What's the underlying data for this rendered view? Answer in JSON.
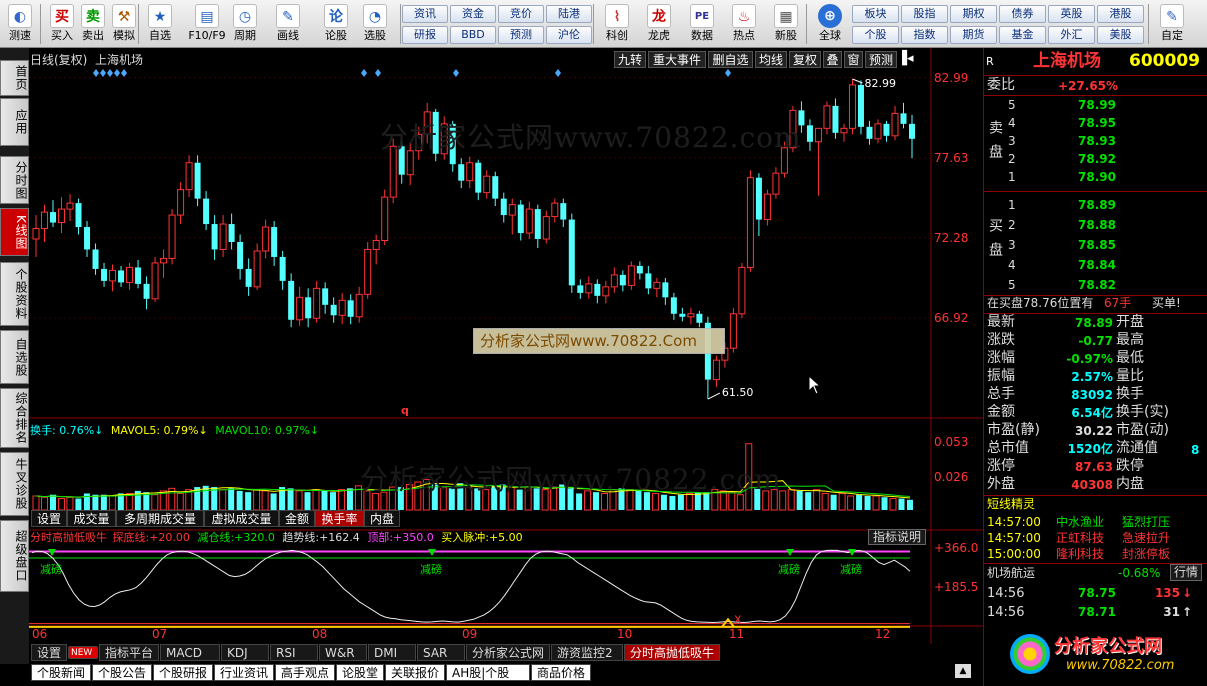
{
  "toolbar": {
    "buttons": [
      {
        "label": "测速",
        "glyph": "◐",
        "color": "#3366cc"
      },
      {
        "label": "买入",
        "glyph": "买",
        "color": "#cc0000"
      },
      {
        "label": "卖出",
        "glyph": "卖",
        "color": "#009900"
      },
      {
        "label": "模拟",
        "glyph": "⚒",
        "color": "#aa5500"
      },
      {
        "label": "自选",
        "glyph": "★",
        "color": "#1f5fbf"
      },
      {
        "label": "F10/F9",
        "glyph": "▤",
        "color": "#1f5fbf"
      },
      {
        "label": "周期",
        "glyph": "◷",
        "color": "#1f5fbf"
      },
      {
        "label": "画线",
        "glyph": "✎",
        "color": "#1f5fbf"
      },
      {
        "label": "论股",
        "glyph": "论",
        "color": "#1f5fbf"
      },
      {
        "label": "选股",
        "glyph": "◔",
        "color": "#1f5fbf"
      }
    ],
    "quick_top": [
      "资讯",
      "资金",
      "竞价",
      "陆港"
    ],
    "quick_bottom": [
      "研报",
      "BBD",
      "预测",
      "沪伦"
    ],
    "buttons2": [
      {
        "label": "科创",
        "glyph": "⌇",
        "color": "#cc3333"
      },
      {
        "label": "龙虎",
        "glyph": "龙",
        "color": "#cc0000"
      },
      {
        "label": "数据",
        "glyph": "PE",
        "color": "#333399"
      },
      {
        "label": "热点",
        "glyph": "♨",
        "color": "#cc0000"
      },
      {
        "label": "新股",
        "glyph": "▦",
        "color": "#555"
      }
    ],
    "globe_label": "全球",
    "quick2_top": [
      "板块",
      "股指",
      "期权",
      "债券",
      "英股",
      "港股"
    ],
    "quick2_bottom": [
      "个股",
      "指数",
      "期货",
      "基金",
      "外汇",
      "美股"
    ],
    "custom_label": "自定"
  },
  "left_tabs": [
    "首页",
    "应用",
    "分时图",
    "K线图",
    "个股资料",
    "自选股",
    "综合排名",
    "牛叉诊股",
    "超级盘口"
  ],
  "chart_header": {
    "period": "日线(复权)",
    "stock_name": "上海机场",
    "buttons": [
      "九转",
      "重大事件",
      "删自选",
      "均线",
      "复权",
      "叠",
      "窗",
      "预测"
    ]
  },
  "watermark": "分析家公式网www.70822.com",
  "watermark_box": "分析家公式网www.70822.Com",
  "chart_data": [
    {
      "type": "candlestick",
      "title": "日线(复权) 上海机场",
      "price_labels": [
        "82.99",
        "77.63",
        "72.28",
        "66.92"
      ],
      "ylim": [
        60.5,
        83.5
      ],
      "high_label": "82.99",
      "low_label": "61.50",
      "candles": [
        [
          72.2,
          73.8,
          71.0,
          72.9
        ],
        [
          72.9,
          74.5,
          72.0,
          74.0
        ],
        [
          74.0,
          74.8,
          73.0,
          73.3
        ],
        [
          73.3,
          75.0,
          72.6,
          74.2
        ],
        [
          74.2,
          75.2,
          73.4,
          74.6
        ],
        [
          74.6,
          74.9,
          72.5,
          73.0
        ],
        [
          73.0,
          73.4,
          71.0,
          71.5
        ],
        [
          71.5,
          71.9,
          69.8,
          70.2
        ],
        [
          70.2,
          70.6,
          69.0,
          69.4
        ],
        [
          69.4,
          70.5,
          68.7,
          70.1
        ],
        [
          70.1,
          70.4,
          69.0,
          69.3
        ],
        [
          69.3,
          70.6,
          68.8,
          70.3
        ],
        [
          70.3,
          70.8,
          68.9,
          69.2
        ],
        [
          69.2,
          69.7,
          67.5,
          68.2
        ],
        [
          68.2,
          71.0,
          68.0,
          70.6
        ],
        [
          70.6,
          71.5,
          69.6,
          70.9
        ],
        [
          70.9,
          74.2,
          70.5,
          73.8
        ],
        [
          73.8,
          76.0,
          73.2,
          75.5
        ],
        [
          75.5,
          77.8,
          75.0,
          77.3
        ],
        [
          77.3,
          77.8,
          74.4,
          74.9
        ],
        [
          74.9,
          75.4,
          72.8,
          73.2
        ],
        [
          73.2,
          73.8,
          70.8,
          71.5
        ],
        [
          71.5,
          73.8,
          71.0,
          73.2
        ],
        [
          73.2,
          73.9,
          71.5,
          72.0
        ],
        [
          72.0,
          72.5,
          69.5,
          70.2
        ],
        [
          70.2,
          70.9,
          68.4,
          69.0
        ],
        [
          69.0,
          71.9,
          68.8,
          71.4
        ],
        [
          71.4,
          73.5,
          70.9,
          73.0
        ],
        [
          73.0,
          73.4,
          70.4,
          71.0
        ],
        [
          71.0,
          71.4,
          68.8,
          69.4
        ],
        [
          69.4,
          69.9,
          66.3,
          66.8
        ],
        [
          66.8,
          69.0,
          66.4,
          68.3
        ],
        [
          68.3,
          68.9,
          66.3,
          66.9
        ],
        [
          66.9,
          69.4,
          66.6,
          68.9
        ],
        [
          68.9,
          69.3,
          67.2,
          67.8
        ],
        [
          67.8,
          68.3,
          66.6,
          67.1
        ],
        [
          67.1,
          68.6,
          66.5,
          68.1
        ],
        [
          68.1,
          68.5,
          66.5,
          67.0
        ],
        [
          67.0,
          69.0,
          66.6,
          68.5
        ],
        [
          68.5,
          72.0,
          68.2,
          71.5
        ],
        [
          71.5,
          72.5,
          70.5,
          72.1
        ],
        [
          72.1,
          75.5,
          71.8,
          75.0
        ],
        [
          75.0,
          78.9,
          74.6,
          78.4
        ],
        [
          78.4,
          79.1,
          75.9,
          76.5
        ],
        [
          76.5,
          78.6,
          75.8,
          78.1
        ],
        [
          78.1,
          79.7,
          77.5,
          79.2
        ],
        [
          79.2,
          81.3,
          78.6,
          80.7
        ],
        [
          80.7,
          80.9,
          77.4,
          77.9
        ],
        [
          77.9,
          80.4,
          77.5,
          79.9
        ],
        [
          79.9,
          80.1,
          76.7,
          77.2
        ],
        [
          77.2,
          77.6,
          75.6,
          76.1
        ],
        [
          76.1,
          77.7,
          75.6,
          77.3
        ],
        [
          77.3,
          77.5,
          74.8,
          75.3
        ],
        [
          75.3,
          76.8,
          74.9,
          76.4
        ],
        [
          76.4,
          76.7,
          74.4,
          74.9
        ],
        [
          74.9,
          75.3,
          73.3,
          73.8
        ],
        [
          73.8,
          74.9,
          72.5,
          74.5
        ],
        [
          74.5,
          74.8,
          72.1,
          72.6
        ],
        [
          72.6,
          74.7,
          72.2,
          74.2
        ],
        [
          74.2,
          74.5,
          71.6,
          72.2
        ],
        [
          72.2,
          74.1,
          71.9,
          73.7
        ],
        [
          73.7,
          74.9,
          73.3,
          74.6
        ],
        [
          74.6,
          74.9,
          73.0,
          73.5
        ],
        [
          73.5,
          73.9,
          68.6,
          69.1
        ],
        [
          69.1,
          69.5,
          68.2,
          68.6
        ],
        [
          68.6,
          69.7,
          68.2,
          69.2
        ],
        [
          69.2,
          69.5,
          67.9,
          68.4
        ],
        [
          68.4,
          69.4,
          67.9,
          69.0
        ],
        [
          69.0,
          70.3,
          68.6,
          69.8
        ],
        [
          69.8,
          70.1,
          68.7,
          69.1
        ],
        [
          69.1,
          70.7,
          68.8,
          70.4
        ],
        [
          70.4,
          70.7,
          69.5,
          69.9
        ],
        [
          69.9,
          70.4,
          68.5,
          68.9
        ],
        [
          68.9,
          69.6,
          68.3,
          69.3
        ],
        [
          69.3,
          69.6,
          67.8,
          68.3
        ],
        [
          68.3,
          68.6,
          66.8,
          67.2
        ],
        [
          67.2,
          67.6,
          66.7,
          67.0
        ],
        [
          67.0,
          67.6,
          66.5,
          67.2
        ],
        [
          67.2,
          67.4,
          66.3,
          66.6
        ],
        [
          66.6,
          67.0,
          61.5,
          62.8
        ],
        [
          62.8,
          64.4,
          62.3,
          64.1
        ],
        [
          64.1,
          65.3,
          63.6,
          64.9
        ],
        [
          64.9,
          67.6,
          64.6,
          67.2
        ],
        [
          67.2,
          70.6,
          66.9,
          70.3
        ],
        [
          70.3,
          76.8,
          70.0,
          76.3
        ],
        [
          76.3,
          76.6,
          72.4,
          73.5
        ],
        [
          73.5,
          75.5,
          73.1,
          75.2
        ],
        [
          75.2,
          77.0,
          74.9,
          76.6
        ],
        [
          76.6,
          78.7,
          76.3,
          78.3
        ],
        [
          78.3,
          81.1,
          78.0,
          80.8
        ],
        [
          80.8,
          81.4,
          79.3,
          79.8
        ],
        [
          79.8,
          80.2,
          78.1,
          78.7
        ],
        [
          78.7,
          79.1,
          75.1,
          79.6
        ],
        [
          79.6,
          81.4,
          79.2,
          81.1
        ],
        [
          81.1,
          81.6,
          78.9,
          79.3
        ],
        [
          79.3,
          79.9,
          78.7,
          79.6
        ],
        [
          79.6,
          82.9,
          79.2,
          82.5
        ],
        [
          82.5,
          82.8,
          79.2,
          79.7
        ],
        [
          79.7,
          80.1,
          78.5,
          78.9
        ],
        [
          78.9,
          80.2,
          78.6,
          79.9
        ],
        [
          79.9,
          80.1,
          78.7,
          79.1
        ],
        [
          79.1,
          81.1,
          78.8,
          80.6
        ],
        [
          80.6,
          81.3,
          79.6,
          79.9
        ],
        [
          79.9,
          80.5,
          77.6,
          78.9
        ]
      ]
    },
    {
      "type": "bar",
      "title": "换手",
      "series": [
        {
          "name": "换手",
          "label": "0.76%↓"
        },
        {
          "name": "MAVOL5",
          "label": "0.79%↓"
        },
        {
          "name": "MAVOL10",
          "label": "0.97%↓"
        }
      ],
      "axis_labels": [
        "0.053",
        "0.026"
      ],
      "ylim": [
        0,
        0.062
      ],
      "values": [
        0.011,
        0.01,
        0.012,
        0.009,
        0.01,
        0.009,
        0.013,
        0.012,
        0.012,
        0.011,
        0.013,
        0.013,
        0.015,
        0.014,
        0.012,
        0.015,
        0.017,
        0.013,
        0.016,
        0.018,
        0.019,
        0.018,
        0.016,
        0.017,
        0.015,
        0.014,
        0.016,
        0.015,
        0.013,
        0.018,
        0.017,
        0.015,
        0.014,
        0.016,
        0.015,
        0.014,
        0.016,
        0.017,
        0.019,
        0.015,
        0.013,
        0.014,
        0.018,
        0.018,
        0.02,
        0.022,
        0.024,
        0.02,
        0.018,
        0.017,
        0.021,
        0.019,
        0.017,
        0.016,
        0.019,
        0.02,
        0.018,
        0.016,
        0.018,
        0.017,
        0.016,
        0.018,
        0.02,
        0.017,
        0.013,
        0.015,
        0.014,
        0.013,
        0.016,
        0.017,
        0.016,
        0.015,
        0.014,
        0.013,
        0.012,
        0.011,
        0.012,
        0.013,
        0.014,
        0.014,
        0.016,
        0.015,
        0.014,
        0.012,
        0.052,
        0.017,
        0.015,
        0.016,
        0.015,
        0.016,
        0.015,
        0.014,
        0.016,
        0.013,
        0.012,
        0.013,
        0.011,
        0.012,
        0.011,
        0.011,
        0.01,
        0.009,
        0.009,
        0.008
      ]
    },
    {
      "type": "line",
      "title": "分时高抛低吸牛",
      "series": [
        {
          "name": "探底线",
          "label": "+20.00"
        },
        {
          "name": "减仓线",
          "label": "+320.0"
        },
        {
          "name": "趋势线",
          "label": "+162.4"
        },
        {
          "name": "顶部",
          "label": "+350.0"
        },
        {
          "name": "买入脉冲",
          "label": "+5.00"
        }
      ],
      "axis_labels": [
        "+366.0",
        "+185.5"
      ],
      "ylim": [
        0,
        366
      ],
      "values": [
        345,
        352,
        350,
        340,
        320,
        290,
        250,
        200,
        160,
        130,
        110,
        100,
        98,
        105,
        120,
        140,
        155,
        165,
        170,
        175,
        185,
        205,
        230,
        260,
        290,
        315,
        335,
        345,
        350,
        352,
        348,
        340,
        330,
        315,
        300,
        285,
        270,
        255,
        240,
        235,
        238,
        245,
        260,
        280,
        300,
        318,
        330,
        340,
        348,
        352,
        355,
        352,
        345,
        335,
        318,
        300,
        280,
        255,
        230,
        205,
        180,
        160,
        140,
        120,
        105,
        90,
        75,
        60,
        50,
        45,
        42,
        38,
        35,
        33,
        30,
        28,
        27,
        28,
        30,
        32,
        30,
        28,
        27,
        30,
        35,
        40,
        50,
        60,
        75,
        95,
        120,
        150,
        185,
        220,
        255,
        290,
        320,
        338,
        348,
        352,
        350,
        345,
        340,
        335,
        320,
        300,
        285,
        270,
        255,
        240,
        225,
        210,
        195,
        180,
        165,
        150,
        138,
        128,
        120,
        118,
        115,
        105,
        90,
        75,
        60,
        45,
        35,
        30,
        28,
        27,
        26,
        25,
        26,
        28,
        30,
        28,
        26,
        25,
        27,
        30,
        32,
        30,
        28,
        30,
        38,
        55,
        85,
        130,
        190,
        250,
        300,
        335,
        350,
        355,
        356,
        355,
        350,
        345,
        350,
        355,
        352,
        340,
        320,
        300,
        290,
        300,
        310,
        295,
        280,
        260
      ],
      "markers": [
        "减磅",
        "减磅",
        "减磅",
        "减磅"
      ],
      "x_labels": [
        "06",
        "07",
        "08",
        "09",
        "10",
        "11",
        "12"
      ],
      "button": "指标说明"
    }
  ],
  "vol_tabs": [
    "设置",
    "成交量",
    "多周期成交量",
    "虚拟成交量",
    "金额",
    "换手率",
    "内盘"
  ],
  "bottom_tabs": [
    "设置",
    "NEW",
    "指标平台",
    "MACD",
    "KDJ",
    "RSI",
    "W&R",
    "DMI",
    "SAR",
    "分析家公式网",
    "游资监控2",
    "分时高抛低吸牛"
  ],
  "bottom_tabs2": [
    "个股新闻",
    "个股公告",
    "个股研报",
    "行业资讯",
    "高手观点",
    "论股堂",
    "关联报价",
    "AH股|个股",
    "商品价格"
  ],
  "right": {
    "title": "上海机场",
    "code": "600009",
    "flag": "R",
    "weibi_label": "委比",
    "weibi": "+27.65%",
    "sell_label": "卖盘",
    "buy_label": "买盘",
    "sell": [
      [
        "5",
        "78.99"
      ],
      [
        "4",
        "78.95"
      ],
      [
        "3",
        "78.93"
      ],
      [
        "2",
        "78.92"
      ],
      [
        "1",
        "78.90"
      ]
    ],
    "buy": [
      [
        "1",
        "78.89"
      ],
      [
        "2",
        "78.88"
      ],
      [
        "3",
        "78.85"
      ],
      [
        "4",
        "78.84"
      ],
      [
        "5",
        "78.82"
      ]
    ],
    "notice": "在买盘78.76位置有",
    "notice_qty": "67手",
    "notice_act": "买单!",
    "stats": [
      [
        "最新",
        "78.89",
        "开盘"
      ],
      [
        "涨跌",
        "-0.77",
        "最高"
      ],
      [
        "涨幅",
        "-0.97%",
        "最低"
      ],
      [
        "振幅",
        "2.57%",
        "量比"
      ],
      [
        "总手",
        "83092",
        "换手"
      ],
      [
        "金额",
        "6.54亿",
        "换手(实)"
      ],
      [
        "市盈(静)",
        "30.22",
        "市盈(动)"
      ],
      [
        "总市值",
        "1520亿",
        "流通值"
      ],
      [
        "涨停",
        "87.63",
        "跌停"
      ],
      [
        "外盘",
        "40308",
        "内盘"
      ]
    ],
    "sprite_title": "短线精灵",
    "sprite": [
      [
        "14:57:00",
        "中水渔业",
        "猛烈打压"
      ],
      [
        "14:57:00",
        "正虹科技",
        "急速拉升"
      ],
      [
        "15:00:00",
        "隆利科技",
        "封涨停板"
      ]
    ],
    "sector_name": "机场航运",
    "sector_chg": "-0.68%",
    "sector_btn": "行情",
    "ticks": [
      [
        "14:56",
        "78.75",
        "135",
        "↓"
      ],
      [
        "14:56",
        "78.71",
        "31",
        "↑"
      ]
    ],
    "logo": "分析家公式网",
    "logo_url": "www.70822.com"
  }
}
